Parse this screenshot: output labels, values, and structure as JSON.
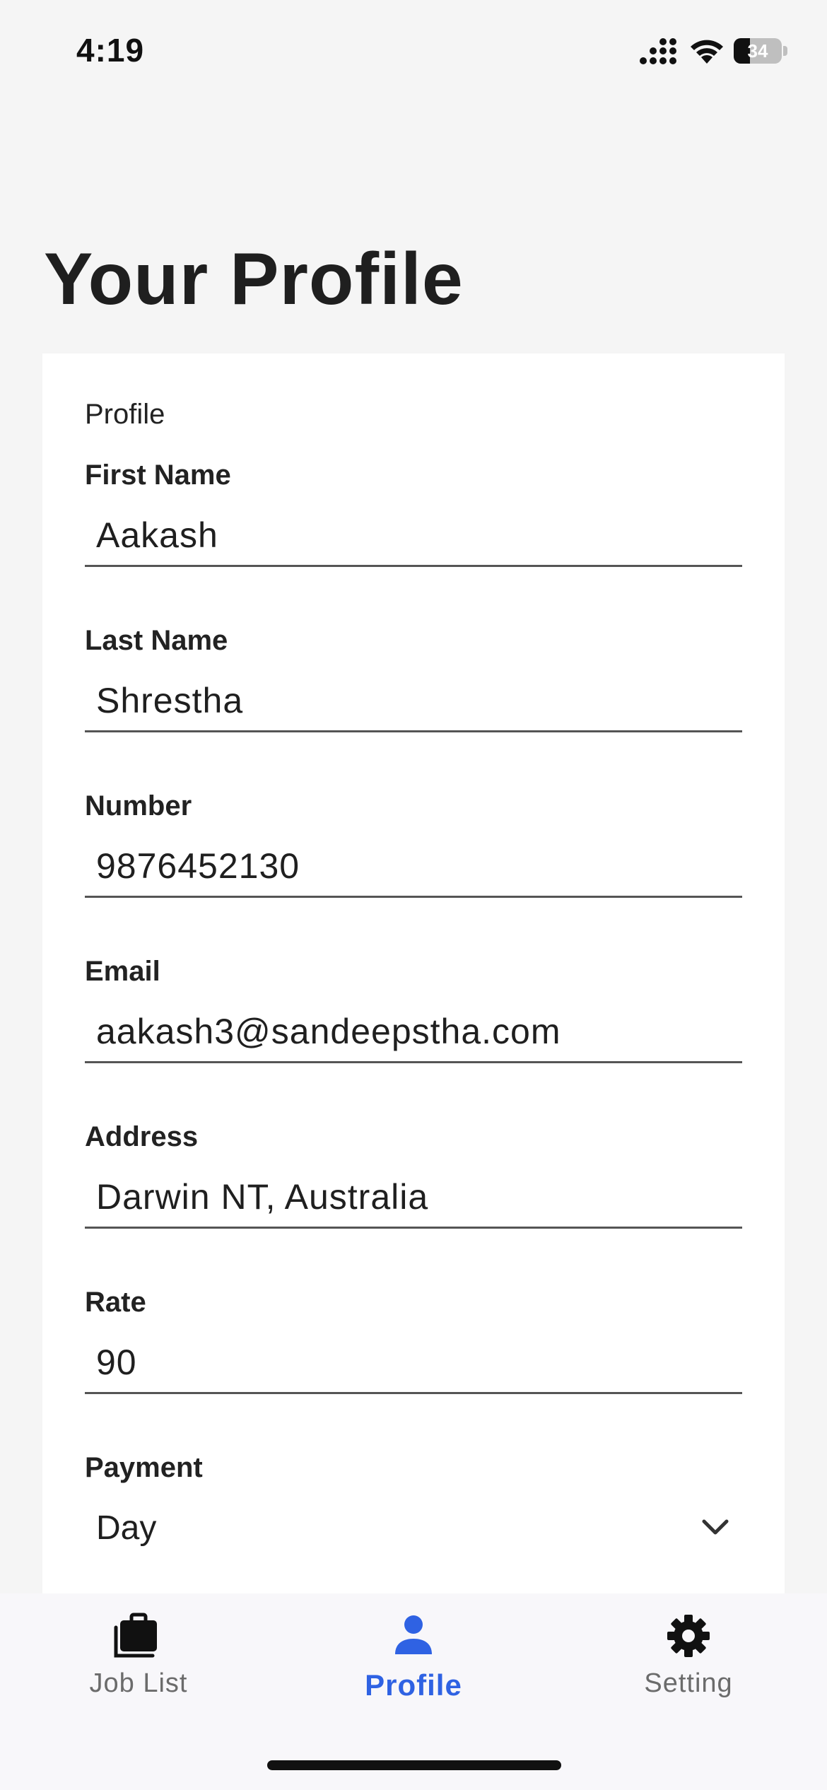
{
  "status_bar": {
    "time": "4:19",
    "battery_percent": "34",
    "battery_level": 0.34
  },
  "page": {
    "title": "Your Profile"
  },
  "form": {
    "section_label": "Profile",
    "fields": [
      {
        "label": "First Name",
        "value": "Aakash"
      },
      {
        "label": "Last Name",
        "value": "Shrestha"
      },
      {
        "label": "Number",
        "value": "9876452130"
      },
      {
        "label": "Email",
        "value": "aakash3@sandeepstha.com"
      },
      {
        "label": "Address",
        "value": "Darwin NT, Australia"
      },
      {
        "label": "Rate",
        "value": "90"
      }
    ],
    "payment": {
      "label": "Payment",
      "selected": "Day"
    }
  },
  "bottom_nav": {
    "items": [
      {
        "label": "Job List",
        "icon": "briefcase-icon"
      },
      {
        "label": "Profile",
        "icon": "person-icon",
        "active": true
      },
      {
        "label": "Setting",
        "icon": "gear-icon"
      }
    ]
  },
  "colors": {
    "accent": "#2f62e3",
    "background": "#f5f5f5",
    "card": "#ffffff",
    "nav_inactive": "#6b6b6b"
  }
}
